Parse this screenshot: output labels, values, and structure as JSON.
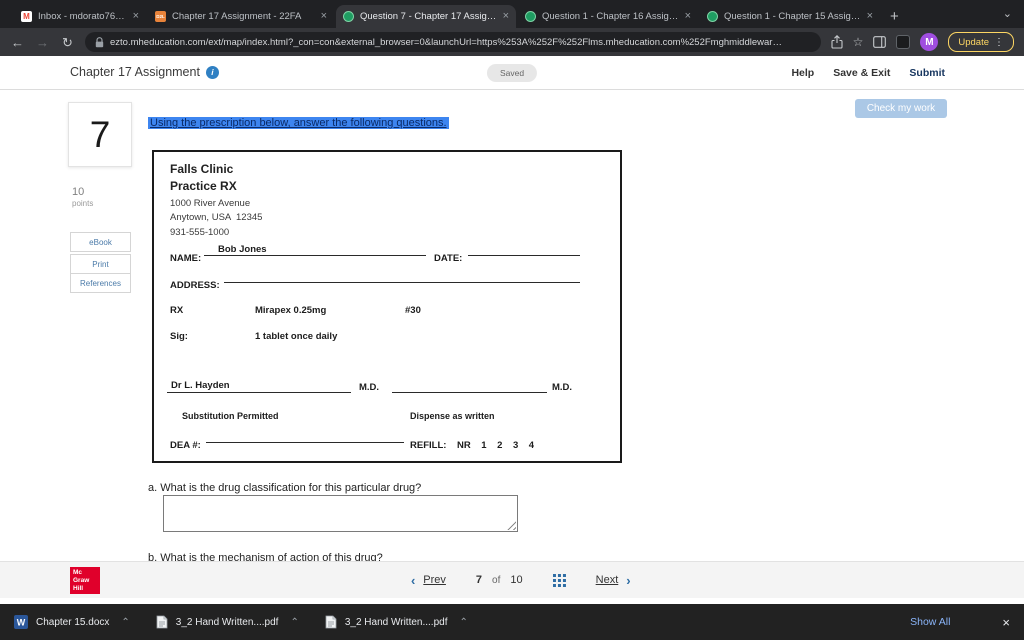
{
  "browser": {
    "tabs": [
      {
        "title": "Inbox - mdorato762@myncc…"
      },
      {
        "title": "Chapter 17 Assignment - 22FA"
      },
      {
        "title": "Question 7 - Chapter 17 Assig…"
      },
      {
        "title": "Question 1 - Chapter 16 Assign…"
      },
      {
        "title": "Question 1 - Chapter 15 Assign…"
      }
    ],
    "url": "ezto.mheducation.com/ext/map/index.html?_con=con&external_browser=0&launchUrl=https%253A%252F%252Flms.mheducation.com%252Fmghmiddlewar…",
    "profile_initial": "M",
    "update_label": "Update",
    "gmail_glyph": "M",
    "d2l_label": "D2L"
  },
  "icons": {
    "close": "×",
    "new_tab": "+",
    "chevron_down": "⌄",
    "back": "←",
    "forward": "→",
    "reload": "↻",
    "star": "☆",
    "overflow": "⋮",
    "caret_up": "⌃",
    "chevron_left": "‹",
    "chevron_right": "›",
    "info": "i"
  },
  "header": {
    "title": "Chapter 17 Assignment",
    "saved_badge": "Saved",
    "help": "Help",
    "save_exit": "Save & Exit",
    "submit": "Submit"
  },
  "question": {
    "number": "7",
    "points_value": "10",
    "points_label": "points",
    "check_work": "Check my work",
    "resources": [
      "eBook",
      "Print",
      "References"
    ],
    "instruction": "Using the prescription below, answer the following questions."
  },
  "prescription": {
    "clinic_name": "Falls Clinic",
    "practice": "Practice RX",
    "address1": "1000 River Avenue",
    "address2": "Anytown, USA  12345",
    "phone": "931-555-1000",
    "name_label": "NAME:",
    "name_value": "Bob Jones",
    "date_label": "DATE:",
    "address_label": "ADDRESS:",
    "rx_label": "RX",
    "drug": "Mirapex 0.25mg",
    "quantity": "#30",
    "sig_label": "Sig:",
    "sig_value": "1 tablet once daily",
    "doctor": "Dr L. Hayden",
    "md1": "M.D.",
    "md2": "M.D.",
    "substitution": "Substitution Permitted",
    "dispense": "Dispense as written",
    "dea_label": "DEA #:",
    "refill_label": "REFILL:",
    "refill_options": "NR    1    2    3    4"
  },
  "sub_questions": {
    "a": "a. What is the drug classification for this particular drug?",
    "b": "b. What is the mechanism of action of this drug?"
  },
  "footer": {
    "logo": {
      "l1": "Mc",
      "l2": "Graw",
      "l3": "Hill"
    },
    "prev": "Prev",
    "page_current": "7",
    "of_label": "of",
    "page_total": "10",
    "next": "Next"
  },
  "downloads": {
    "word_glyph": "W",
    "items": [
      {
        "name": "Chapter 15.docx"
      },
      {
        "name": "3_2 Hand Written....pdf"
      },
      {
        "name": "3_2 Hand Written....pdf"
      }
    ],
    "show_all": "Show All"
  },
  "colors": {
    "mcgraw_red": "#e0002b",
    "accent_blue": "#2e6da4",
    "highlight_blue": "#3d85f0",
    "check_work_blue": "#abc8e6",
    "avatar_purple": "#a04ee0",
    "update_yellow": "#fdd663"
  }
}
